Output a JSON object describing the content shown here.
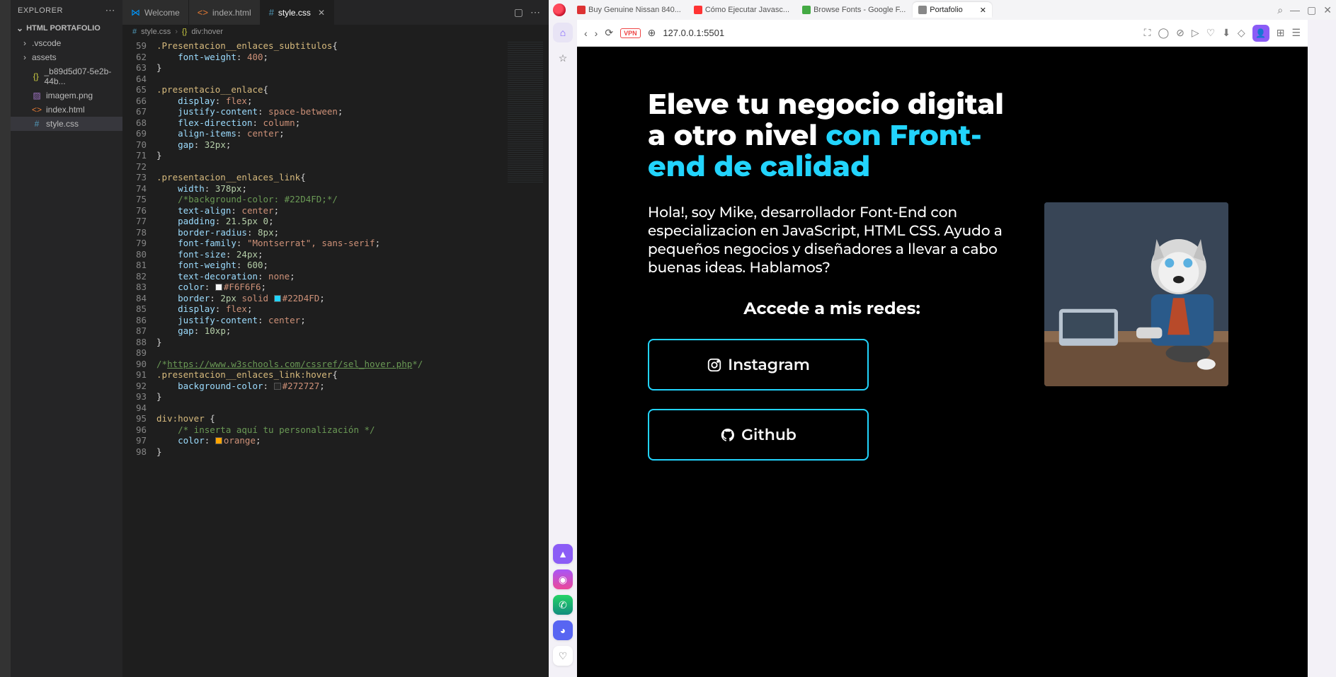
{
  "vscode": {
    "explorer_label": "EXPLORER",
    "project_name": "HTML PORTAFOLIO",
    "tree": [
      {
        "type": "folder",
        "name": ".vscode"
      },
      {
        "type": "folder",
        "name": "assets"
      },
      {
        "type": "file",
        "name": "_b89d5d07-5e2b-44b...",
        "icon": "json"
      },
      {
        "type": "file",
        "name": "imagem.png",
        "icon": "img"
      },
      {
        "type": "file",
        "name": "index.html",
        "icon": "html"
      },
      {
        "type": "file",
        "name": "style.css",
        "icon": "css",
        "active": true
      }
    ],
    "tabs": [
      {
        "label": "Welcome",
        "icon": "vscode"
      },
      {
        "label": "index.html",
        "icon": "html"
      },
      {
        "label": "style.css",
        "icon": "css",
        "active": true,
        "closable": true
      }
    ],
    "breadcrumb": {
      "file": "style.css",
      "symbol": "div:hover"
    }
  },
  "code": {
    "lines": [
      {
        "n": 59,
        "t": ".Presentacion__enlaces_subtitulos{",
        "cls": "sel"
      },
      {
        "n": 62,
        "t": "    font-weight: 400;",
        "cls": "decl"
      },
      {
        "n": 63,
        "t": "}",
        "cls": "punct"
      },
      {
        "n": 64,
        "t": "",
        "cls": ""
      },
      {
        "n": 65,
        "t": ".presentacio__enlace{",
        "cls": "sel"
      },
      {
        "n": 66,
        "t": "    display: flex;",
        "cls": "decl"
      },
      {
        "n": 67,
        "t": "    justify-content: space-between;",
        "cls": "decl"
      },
      {
        "n": 68,
        "t": "    flex-direction: column;",
        "cls": "decl"
      },
      {
        "n": 69,
        "t": "    align-items: center;",
        "cls": "decl"
      },
      {
        "n": 70,
        "t": "    gap: 32px;",
        "cls": "declnum"
      },
      {
        "n": 71,
        "t": "}",
        "cls": "punct"
      },
      {
        "n": 72,
        "t": "",
        "cls": ""
      },
      {
        "n": 73,
        "t": ".presentacion__enlaces_link{",
        "cls": "sel"
      },
      {
        "n": 74,
        "t": "    width: 378px;",
        "cls": "declnum"
      },
      {
        "n": 75,
        "t": "    /*background-color: #22D4FD;*/",
        "cls": "comment"
      },
      {
        "n": 76,
        "t": "    text-align: center;",
        "cls": "decl"
      },
      {
        "n": 77,
        "t": "    padding: 21.5px 0;",
        "cls": "declnum"
      },
      {
        "n": 78,
        "t": "    border-radius: 8px;",
        "cls": "declnum"
      },
      {
        "n": 79,
        "t": "    font-family: \"Montserrat\", sans-serif;",
        "cls": "declstr"
      },
      {
        "n": 80,
        "t": "    font-size: 24px;",
        "cls": "declnum"
      },
      {
        "n": 81,
        "t": "    font-weight: 600;",
        "cls": "declnum"
      },
      {
        "n": 82,
        "t": "    text-decoration: none;",
        "cls": "decl"
      },
      {
        "n": 83,
        "t": "    color: #F6F6F6;",
        "cls": "color1"
      },
      {
        "n": 84,
        "t": "    border: 2px solid #22D4FD;",
        "cls": "color2"
      },
      {
        "n": 85,
        "t": "    display: flex;",
        "cls": "decl"
      },
      {
        "n": 86,
        "t": "    justify-content: center;",
        "cls": "decl"
      },
      {
        "n": 87,
        "t": "    gap: 10xp;",
        "cls": "declnum"
      },
      {
        "n": 88,
        "t": "}",
        "cls": "punct"
      },
      {
        "n": 89,
        "t": "",
        "cls": ""
      },
      {
        "n": 90,
        "t": "/*https://www.w3schools.com/cssref/sel_hover.php*/",
        "cls": "commentlink"
      },
      {
        "n": 91,
        "t": ".presentacion__enlaces_link:hover{",
        "cls": "sel"
      },
      {
        "n": 92,
        "t": "    background-color: #272727;",
        "cls": "color3"
      },
      {
        "n": 93,
        "t": "}",
        "cls": "punct"
      },
      {
        "n": 94,
        "t": "",
        "cls": ""
      },
      {
        "n": 95,
        "t": "div:hover {",
        "cls": "sel"
      },
      {
        "n": 96,
        "t": "    /* inserta aquí tu personalización */",
        "cls": "comment"
      },
      {
        "n": 97,
        "t": "    color: orange;",
        "cls": "color4"
      },
      {
        "n": 98,
        "t": "}",
        "cls": "punct"
      }
    ]
  },
  "browser": {
    "tabs": [
      {
        "label": "Buy Genuine Nissan 840...",
        "color": "#d33"
      },
      {
        "label": "Cómo Ejecutar Javasc...",
        "color": "#f33"
      },
      {
        "label": "Browse Fonts - Google F...",
        "color": "#4a4"
      },
      {
        "label": "Portafolio",
        "color": "#888",
        "active": true,
        "closable": true
      }
    ],
    "url": "127.0.0.1:5501",
    "vpn_label": "VPN"
  },
  "page": {
    "title_plain": "Eleve tu negocio digital a otro nivel ",
    "title_accent": "con Front-end de calidad",
    "desc": "Hola!, soy Mike, desarrollador Font-End con especializacion en JavaScript, HTML CSS. Ayudo a pequeños negocios y diseñadores a llevar a cabo buenas ideas. Hablamos?",
    "subtitle": "Accede a mis redes:",
    "links": [
      {
        "label": "Instagram",
        "icon": "instagram"
      },
      {
        "label": "Github",
        "icon": "github"
      }
    ]
  }
}
